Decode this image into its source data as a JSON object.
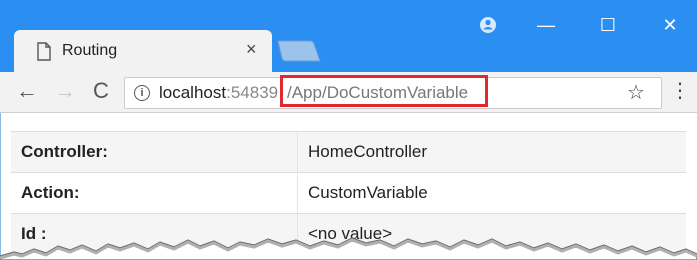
{
  "browser": {
    "tab": {
      "title": "Routing",
      "close_glyph": "×"
    },
    "window_controls": {
      "profile_icon": "person-circle-icon",
      "minimize_glyph": "—",
      "maximize_glyph": "☐",
      "close_glyph": "✕"
    },
    "toolbar": {
      "back_glyph": "←",
      "forward_glyph": "→",
      "reload_glyph": "C",
      "info_glyph": "i",
      "url_host": "localhost",
      "url_port": ":54839",
      "url_path": "/App/DoCustomVariable",
      "star_glyph": "☆",
      "menu_glyph": "⋮"
    },
    "colors": {
      "titlebar": "#2b8ff2",
      "highlight": "#e0282e"
    }
  },
  "table": {
    "rows": [
      {
        "key": "Controller:",
        "value": "HomeController"
      },
      {
        "key": "Action:",
        "value": "CustomVariable"
      },
      {
        "key": "Id :",
        "value": "<no value>"
      }
    ]
  }
}
